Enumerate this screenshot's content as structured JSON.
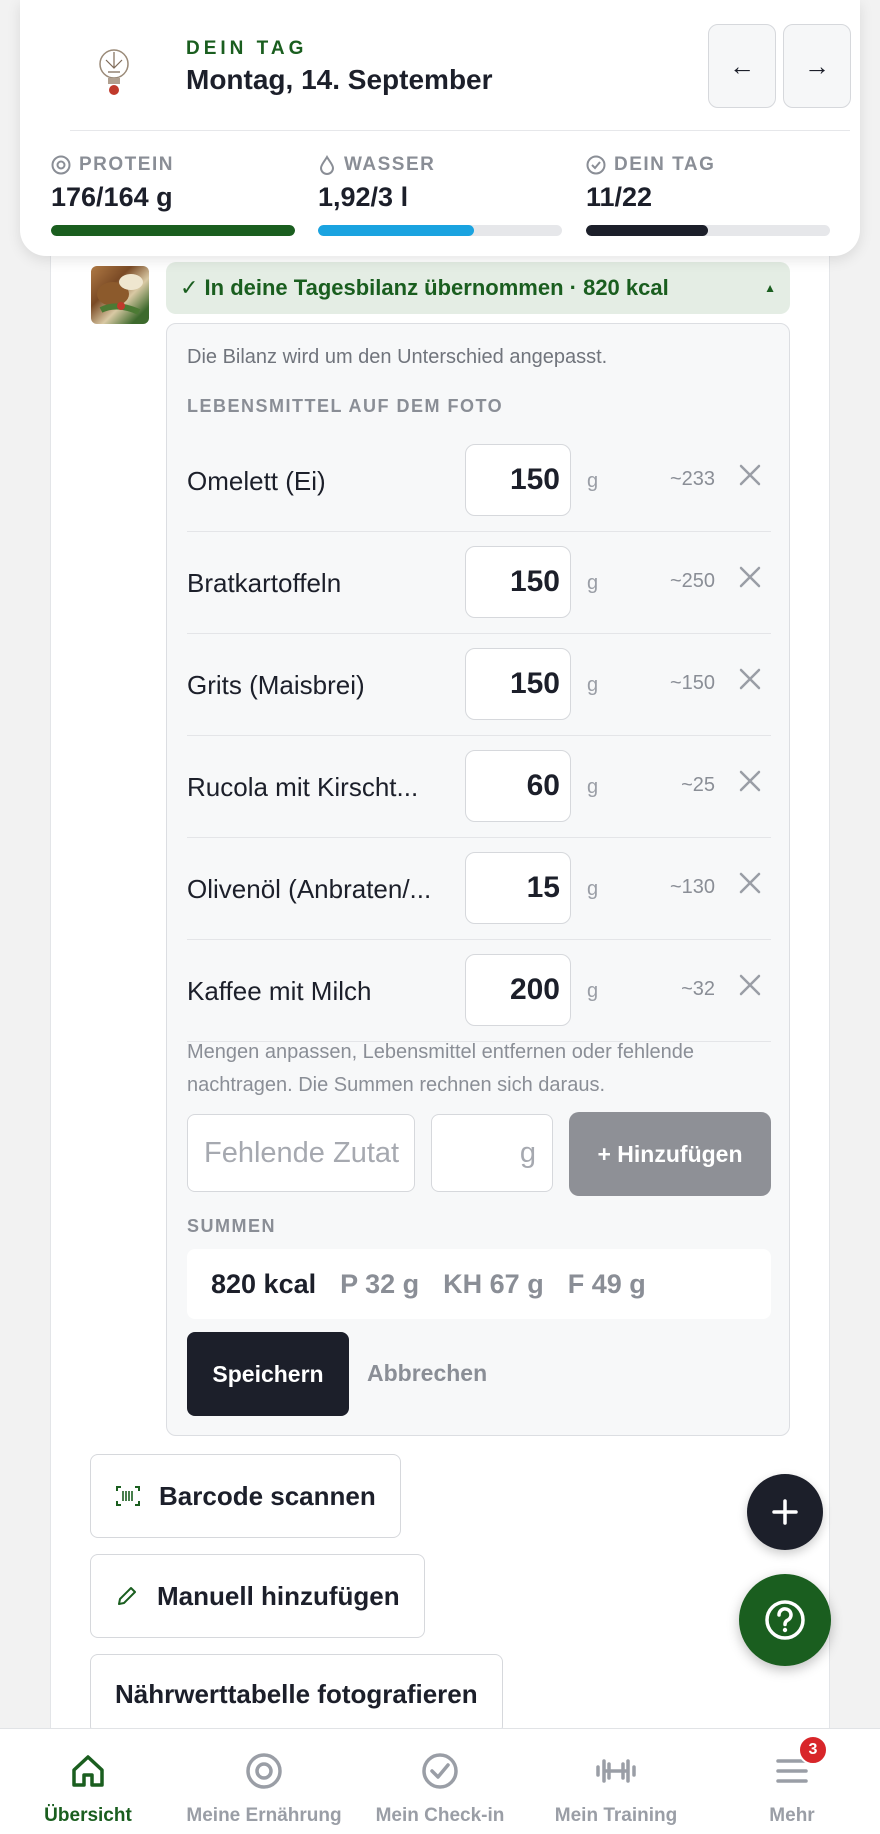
{
  "header": {
    "eyebrow": "DEIN TAG",
    "date": "Montag, 14. September",
    "prev_label": "←",
    "next_label": "→",
    "stats": [
      {
        "label": "PROTEIN",
        "value": "176/164 g",
        "progress": 1.0,
        "color": "#1a5e1f",
        "icon": "target-icon"
      },
      {
        "label": "WASSER",
        "value": "1,92/3 l",
        "progress": 0.64,
        "color": "#1aa3e0",
        "icon": "water-drop-icon"
      },
      {
        "label": "DEIN TAG",
        "value": "11/22",
        "progress": 0.5,
        "color": "#1c1f2a",
        "icon": "check-circle-icon"
      }
    ]
  },
  "meal": {
    "banner": "✓ In deine Tagesbilanz übernommen · 820 kcal",
    "hint": "Die Bilanz wird um den Unterschied angepasst.",
    "foods_label": "LEBENSMITTEL AUF DEM FOTO",
    "foods": [
      {
        "name": "Omelett (Ei)",
        "qty": "150",
        "unit": "g",
        "kcal": "~233"
      },
      {
        "name": "Bratkartoffeln",
        "qty": "150",
        "unit": "g",
        "kcal": "~250"
      },
      {
        "name": "Grits (Maisbrei)",
        "qty": "150",
        "unit": "g",
        "kcal": "~150"
      },
      {
        "name": "Rucola mit Kirscht...",
        "qty": "60",
        "unit": "g",
        "kcal": "~25"
      },
      {
        "name": "Olivenöl (Anbraten/...",
        "qty": "15",
        "unit": "g",
        "kcal": "~130"
      },
      {
        "name": "Kaffee mit Milch",
        "qty": "200",
        "unit": "g",
        "kcal": "~32"
      }
    ],
    "edit_hint": "Mengen anpassen, Lebensmittel entfernen oder fehlende nachtragen. Die Summen rechnen sich daraus.",
    "add_placeholder": "Fehlende Zutat",
    "add_unit_placeholder": "g",
    "add_button": "+ Hinzufügen",
    "sums_label": "SUMMEN",
    "sums": {
      "kcal": "820 kcal",
      "protein": "P 32 g",
      "carbs": "KH 67 g",
      "fat": "F 49 g"
    },
    "save": "Speichern",
    "cancel": "Abbrechen"
  },
  "actions": {
    "barcode": "Barcode scannen",
    "manual": "Manuell hinzufügen",
    "nutrition_photo": "Nährwerttabelle fotografieren"
  },
  "bottom_nav": [
    {
      "label": "Übersicht",
      "icon": "home-icon",
      "active": true
    },
    {
      "label": "Meine Ernährung",
      "icon": "target-icon",
      "active": false
    },
    {
      "label": "Mein Check-in",
      "icon": "check-circle-icon",
      "active": false
    },
    {
      "label": "Mein Training",
      "icon": "dumbbell-icon",
      "active": false
    },
    {
      "label": "Mehr",
      "icon": "menu-icon",
      "active": false,
      "badge": "3"
    }
  ]
}
